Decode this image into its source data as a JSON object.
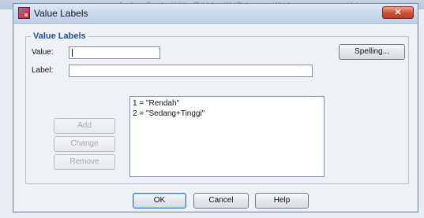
{
  "background": {
    "texts": [
      "Analyze Graphs Utilities Add-ons Window",
      "Transform",
      "Data",
      "Window",
      "Help"
    ]
  },
  "dialog": {
    "title": "Value Labels",
    "close_label": "✕",
    "group_label": "Value Labels",
    "value_label": "Value:",
    "value_input": "",
    "label_label": "Label:",
    "label_input": "",
    "spelling_button": "Spelling...",
    "add_button": "Add",
    "change_button": "Change",
    "remove_button": "Remove",
    "list_items": [
      "1 = \"Rendah\"",
      "2 = \"Sedang+Tinggi\""
    ],
    "ok_button": "OK",
    "cancel_button": "Cancel",
    "help_button": "Help"
  },
  "colors": {
    "group_label": "#1f4f9a",
    "close_button": "#cf4d33",
    "titlebar": "#c9d8ec"
  }
}
